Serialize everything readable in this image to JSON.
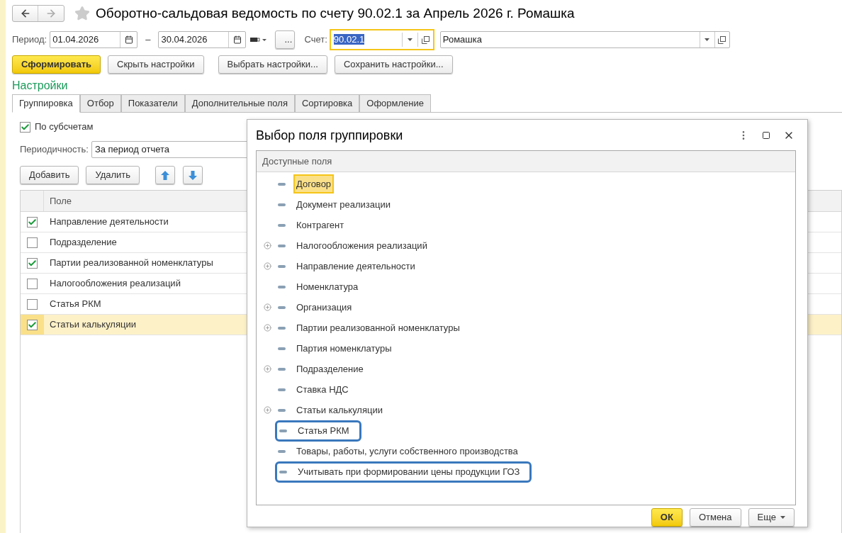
{
  "window": {
    "title": "Оборотно-сальдовая ведомость по счету 90.02.1 за Апрель 2026 г. Ромашка"
  },
  "filters": {
    "period_label": "Период:",
    "date_from": "01.04.2026",
    "separator": "–",
    "date_to": "30.04.2026",
    "more_button": "...",
    "account_label": "Счет:",
    "account_value": "90.02.1",
    "account_text_selected": true,
    "organization_value": "Ромашка"
  },
  "toolbar": [
    {
      "label": "Сформировать",
      "kind": "primary"
    },
    {
      "label": "Скрыть настройки",
      "kind": "default"
    },
    {
      "label": "Выбрать настройки...",
      "kind": "default"
    },
    {
      "label": "Сохранить настройки...",
      "kind": "default"
    }
  ],
  "settings_title": "Настройки",
  "tabs": [
    {
      "label": "Группировка",
      "selected": true
    },
    {
      "label": "Отбор",
      "selected": false
    },
    {
      "label": "Показатели",
      "selected": false
    },
    {
      "label": "Дополнительные поля",
      "selected": false
    },
    {
      "label": "Сортировка",
      "selected": false
    },
    {
      "label": "Оформление",
      "selected": false
    }
  ],
  "subaccounts": {
    "label": "По субсчетам",
    "checked": true
  },
  "periodicity": {
    "label": "Периодичность:",
    "value": "За период отчета"
  },
  "grouping_buttons": [
    "Добавить",
    "Удалить"
  ],
  "table": {
    "columns": [
      "Поле"
    ],
    "rows": [
      {
        "field": "Направление деятельности",
        "checked": true,
        "selected": false
      },
      {
        "field": "Подразделение",
        "checked": false,
        "selected": false
      },
      {
        "field": "Партии реализованной номенклатуры",
        "checked": true,
        "selected": false
      },
      {
        "field": "Налогообложения реализаций",
        "checked": false,
        "selected": false
      },
      {
        "field": "Статья РКМ",
        "checked": false,
        "selected": false
      },
      {
        "field": "Статьи калькуляции",
        "checked": true,
        "selected": true
      }
    ]
  },
  "dialog": {
    "title": "Выбор поля группировки",
    "tree_header": "Доступные поля",
    "items": [
      {
        "label": "Договор",
        "expandable": false,
        "selected": true,
        "highlighted": false
      },
      {
        "label": "Документ реализации",
        "expandable": false,
        "selected": false,
        "highlighted": false
      },
      {
        "label": "Контрагент",
        "expandable": false,
        "selected": false,
        "highlighted": false
      },
      {
        "label": "Налогообложения реализаций",
        "expandable": true,
        "selected": false,
        "highlighted": false
      },
      {
        "label": "Направление деятельности",
        "expandable": true,
        "selected": false,
        "highlighted": false
      },
      {
        "label": "Номенклатура",
        "expandable": false,
        "selected": false,
        "highlighted": false
      },
      {
        "label": "Организация",
        "expandable": true,
        "selected": false,
        "highlighted": false
      },
      {
        "label": "Партии реализованной номенклатуры",
        "expandable": true,
        "selected": false,
        "highlighted": false
      },
      {
        "label": "Партия номенклатуры",
        "expandable": false,
        "selected": false,
        "highlighted": false
      },
      {
        "label": "Подразделение",
        "expandable": true,
        "selected": false,
        "highlighted": false
      },
      {
        "label": "Ставка НДС",
        "expandable": false,
        "selected": false,
        "highlighted": false
      },
      {
        "label": "Статьи калькуляции",
        "expandable": true,
        "selected": false,
        "highlighted": false
      },
      {
        "label": "Статья РКМ",
        "expandable": false,
        "selected": false,
        "highlighted": true
      },
      {
        "label": "Товары, работы, услуги собственного производства",
        "expandable": false,
        "selected": false,
        "highlighted": false
      },
      {
        "label": "Учитывать при формировании цены продукции ГОЗ",
        "expandable": false,
        "selected": false,
        "highlighted": true
      }
    ],
    "buttons": [
      {
        "label": "ОК",
        "kind": "primary"
      },
      {
        "label": "Отмена",
        "kind": "default"
      },
      {
        "label": "Еще",
        "kind": "menu"
      }
    ]
  }
}
